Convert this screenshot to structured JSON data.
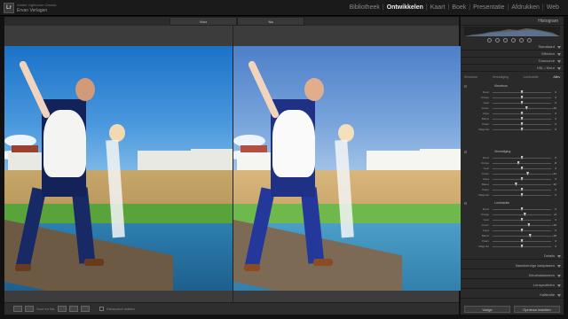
{
  "app": {
    "logo_mark": "Lr",
    "logo_line1": "Adobe Lightroom Classic",
    "logo_line2": "Ervan Verlagen"
  },
  "modules": [
    {
      "label": "Bibliotheek",
      "active": false
    },
    {
      "label": "Ontwikkelen",
      "active": true
    },
    {
      "label": "Kaart",
      "active": false
    },
    {
      "label": "Boek",
      "active": false
    },
    {
      "label": "Presentatie",
      "active": false
    },
    {
      "label": "Afdrukken",
      "active": false
    },
    {
      "label": "Web",
      "active": false
    }
  ],
  "view": {
    "before_label": "Voor",
    "after_label": "Na"
  },
  "bottom_toolbar": {
    "before_after_label": "Voor en Na:",
    "soft_proof_label": "Kleurproof maken"
  },
  "right_panel": {
    "histogram_title": "Histogram",
    "sections_top": [
      "Standaard",
      "Effecten",
      "Tooncurve",
      "HSL / Kleur"
    ],
    "hsl_tabs": [
      "Kleurtoon",
      "Verzadiging",
      "Luminantie",
      "Alles"
    ],
    "hsl_active_tab": "Alles",
    "groups": [
      {
        "title": "Kleurtoon",
        "rows": [
          {
            "label": "Rood",
            "value": "0",
            "pos": 0.5
          },
          {
            "label": "Oranje",
            "value": "0",
            "pos": 0.5
          },
          {
            "label": "Geel",
            "value": "0",
            "pos": 0.5
          },
          {
            "label": "Groen",
            "value": "+10",
            "pos": 0.58
          },
          {
            "label": "Aqua",
            "value": "0",
            "pos": 0.5
          },
          {
            "label": "Blauw",
            "value": "0",
            "pos": 0.5
          },
          {
            "label": "Paars",
            "value": "0",
            "pos": 0.5
          },
          {
            "label": "Magenta",
            "value": "0",
            "pos": 0.5
          }
        ]
      },
      {
        "title": "Verzadiging",
        "rows": [
          {
            "label": "Rood",
            "value": "0",
            "pos": 0.5
          },
          {
            "label": "Oranje",
            "value": "-8",
            "pos": 0.44
          },
          {
            "label": "Geel",
            "value": "0",
            "pos": 0.5
          },
          {
            "label": "Groen",
            "value": "+12",
            "pos": 0.6
          },
          {
            "label": "Aqua",
            "value": "0",
            "pos": 0.5
          },
          {
            "label": "Blauw",
            "value": "-20",
            "pos": 0.4
          },
          {
            "label": "Paars",
            "value": "0",
            "pos": 0.5
          },
          {
            "label": "Magenta",
            "value": "0",
            "pos": 0.5
          }
        ]
      },
      {
        "title": "Luminantie",
        "rows": [
          {
            "label": "Rood",
            "value": "0",
            "pos": 0.5
          },
          {
            "label": "Oranje",
            "value": "+6",
            "pos": 0.55
          },
          {
            "label": "Geel",
            "value": "0",
            "pos": 0.5
          },
          {
            "label": "Groen",
            "value": "+15",
            "pos": 0.62
          },
          {
            "label": "Aqua",
            "value": "0",
            "pos": 0.5
          },
          {
            "label": "Blauw",
            "value": "+18",
            "pos": 0.64
          },
          {
            "label": "Paars",
            "value": "0",
            "pos": 0.5
          },
          {
            "label": "Magenta",
            "value": "0",
            "pos": 0.5
          }
        ]
      }
    ],
    "sections_bottom": [
      "Details",
      "Nauwkeurige aanpassen",
      "Kleurbalanceren",
      "Lensprofielen",
      "Kalibratie"
    ],
    "button_previous": "Vorige",
    "button_reset": "Opnieuw instellen"
  },
  "colors": {
    "accent_active": "#eeeeee",
    "panel_bg": "#2a2a2a"
  }
}
